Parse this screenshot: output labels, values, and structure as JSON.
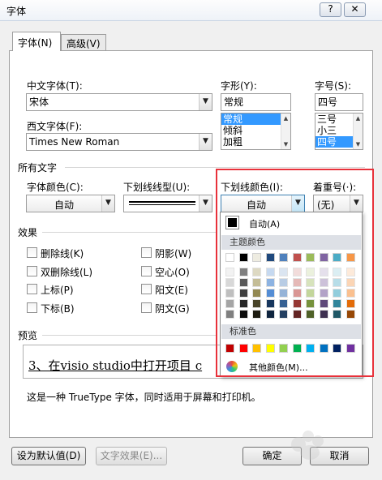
{
  "window": {
    "title": "字体",
    "help_label": "?",
    "close_label": "✕"
  },
  "tabs": [
    {
      "label": "字体(N)"
    },
    {
      "label": "高级(V)"
    }
  ],
  "fields": {
    "cn_font_label": "中文字体(T):",
    "cn_font_value": "宋体",
    "west_font_label": "西文字体(F):",
    "west_font_value": "Times New Roman",
    "style_label": "字形(Y):",
    "style_value": "常规",
    "style_options": [
      "常规",
      "倾斜",
      "加粗"
    ],
    "size_label": "字号(S):",
    "size_value": "四号",
    "size_options": [
      "三号",
      "小三",
      "四号"
    ]
  },
  "all_text": {
    "section_label": "所有文字",
    "font_color_label": "字体颜色(C):",
    "font_color_value": "自动",
    "underline_style_label": "下划线线型(U):",
    "underline_color_label": "下划线颜色(I):",
    "underline_color_value": "自动",
    "emphasis_label": "着重号(·):",
    "emphasis_value": "(无)"
  },
  "effects": {
    "section_label": "效果",
    "left": [
      "删除线(K)",
      "双删除线(L)",
      "上标(P)",
      "下标(B)"
    ],
    "right": [
      "阴影(W)",
      "空心(O)",
      "阳文(E)",
      "阴文(G)"
    ]
  },
  "preview": {
    "section_label": "预览",
    "sample_text": "3、在visio studio中打开项目 c",
    "description": "这是一种 TrueType 字体，同时适用于屏幕和打印机。"
  },
  "color_popup": {
    "auto_label": "自动(A)",
    "theme_label": "主题颜色",
    "standard_label": "标准色",
    "more_label": "其他颜色(M)...",
    "theme_top": [
      "#ffffff",
      "#000000",
      "#eeece1",
      "#1f497d",
      "#4f81bd",
      "#c0504d",
      "#9bbb59",
      "#8064a2",
      "#4bacc6",
      "#f79646"
    ],
    "theme_shades": [
      [
        "#f2f2f2",
        "#d8d8d8",
        "#bfbfbf",
        "#a5a5a5",
        "#7f7f7f"
      ],
      [
        "#7f7f7f",
        "#595959",
        "#3f3f3f",
        "#262626",
        "#0c0c0c"
      ],
      [
        "#ddd9c3",
        "#c4bd97",
        "#938953",
        "#494429",
        "#1d1b10"
      ],
      [
        "#c6d9f0",
        "#8db3e2",
        "#548dd4",
        "#17365d",
        "#0f243e"
      ],
      [
        "#dbe5f1",
        "#b8cce4",
        "#95b3d7",
        "#366092",
        "#244061"
      ],
      [
        "#f2dcdb",
        "#e5b9b7",
        "#d99694",
        "#953734",
        "#632423"
      ],
      [
        "#ebf1dd",
        "#d7e3bc",
        "#c3d69b",
        "#76923c",
        "#4f6128"
      ],
      [
        "#e5e0ec",
        "#ccc1d9",
        "#b2a2c7",
        "#5f497a",
        "#3f3151"
      ],
      [
        "#dbeef3",
        "#b7dde8",
        "#92cddc",
        "#31859b",
        "#205867"
      ],
      [
        "#fdeada",
        "#fbd5b5",
        "#fac08f",
        "#e36c09",
        "#974806"
      ]
    ],
    "standard": [
      "#c00000",
      "#ff0000",
      "#ffc000",
      "#ffff00",
      "#92d050",
      "#00b050",
      "#00b0f0",
      "#0070c0",
      "#002060",
      "#7030a0"
    ]
  },
  "buttons": {
    "set_default": "设为默认值(D)",
    "text_effects": "文字效果(E)...",
    "ok": "确定",
    "cancel": "取消"
  },
  "colors": {
    "highlight_box": "#e8313a",
    "selection": "#3399ff"
  }
}
